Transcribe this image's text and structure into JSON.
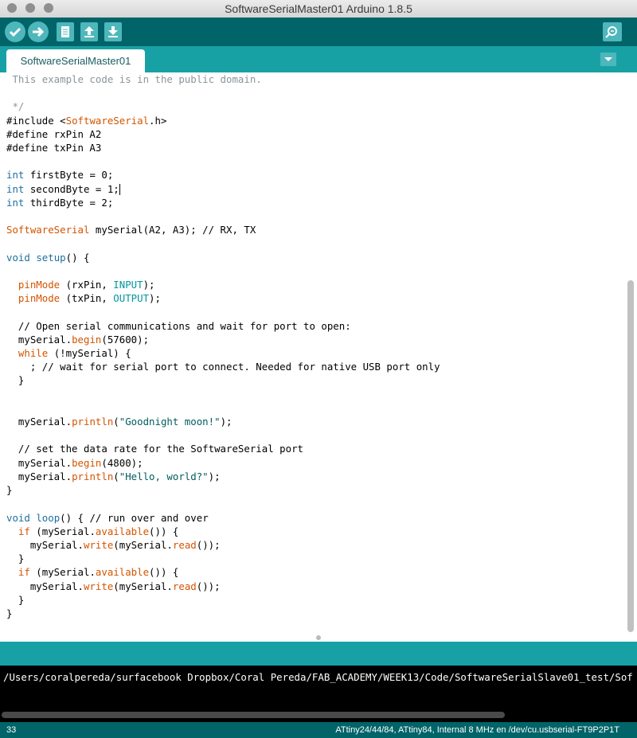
{
  "window": {
    "title": "SoftwareSerialMaster01 Arduino 1.8.5"
  },
  "toolbar": {
    "verify_icon": "checkmark-icon",
    "upload_icon": "arrow-right-icon",
    "new_icon": "document-icon",
    "open_icon": "arrow-up-icon",
    "save_icon": "arrow-down-icon",
    "serial_monitor_icon": "magnifier-icon"
  },
  "tabs": [
    {
      "label": "SoftwareSerialMaster01"
    }
  ],
  "colors": {
    "toolbar": "#006468",
    "tabbar": "#17a1a5",
    "button": "#4db7bb",
    "keyword": "#1f6fa0",
    "function": "#d35400",
    "constant": "#00979c",
    "comment": "#8b959b"
  },
  "editor": {
    "lines": [
      " This example code is in the public domain.",
      "",
      " */",
      "#include <SoftwareSerial.h>",
      "#define rxPin A2",
      "#define txPin A3",
      "",
      "int firstByte = 0;",
      "int secondByte = 1;",
      "int thirdByte = 2;",
      "",
      "SoftwareSerial mySerial(A2, A3); // RX, TX",
      "",
      "void setup() {",
      "",
      "  pinMode (rxPin, INPUT);",
      "  pinMode (txPin, OUTPUT);",
      "",
      "  // Open serial communications and wait for port to open:",
      "  mySerial.begin(57600);",
      "  while (!mySerial) {",
      "    ; // wait for serial port to connect. Needed for native USB port only",
      "  }",
      "",
      "",
      "  mySerial.println(\"Goodnight moon!\");",
      "",
      "  // set the data rate for the SoftwareSerial port",
      "  mySerial.begin(4800);",
      "  mySerial.println(\"Hello, world?\");",
      "}",
      "",
      "void loop() { // run over and over",
      "  if (mySerial.available()) {",
      "    mySerial.write(mySerial.read());",
      "  }",
      "  if (mySerial.available()) {",
      "    mySerial.write(mySerial.read());",
      "  }",
      "}"
    ]
  },
  "console": {
    "text": "/Users/coralpereda/surfacebook Dropbox/Coral Pereda/FAB_ACADEMY/WEEK13/Code/SoftwareSerialSlave01_test/Sof"
  },
  "status": {
    "line": "33",
    "board": "ATtiny24/44/84, ATtiny84, Internal 8 MHz en /dev/cu.usbserial-FT9P2P1T"
  }
}
